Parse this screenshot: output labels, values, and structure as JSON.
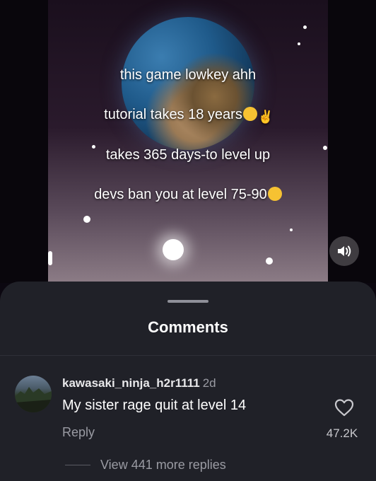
{
  "video": {
    "caption_lines": [
      "this game lowkey ahh",
      "tutorial takes 18 years",
      "takes 365 days-to level up",
      "devs ban you at level 75-90"
    ],
    "icons": {
      "sound": "speaker-icon"
    }
  },
  "comments_panel": {
    "title": "Comments",
    "comment": {
      "username": "kawasaki_ninja_h2r1111",
      "timestamp": "2d",
      "text": "My sister rage quit at level 14",
      "reply_label": "Reply",
      "like_count": "47.2K"
    },
    "view_replies_label": "View 441 more replies"
  },
  "colors": {
    "sheet_bg": "#202128",
    "secondary_text": "#9a9ba3",
    "primary_text": "#ffffff"
  }
}
